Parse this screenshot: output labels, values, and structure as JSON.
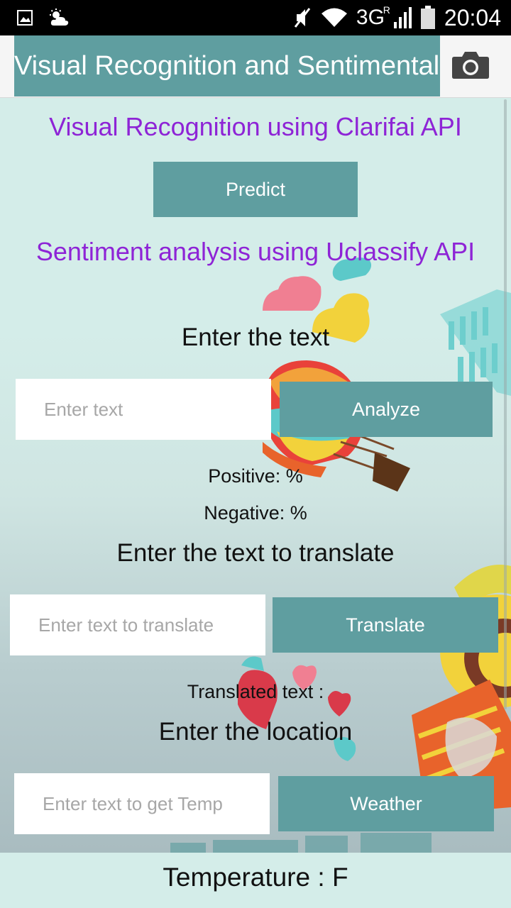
{
  "status_bar": {
    "network": "3G",
    "roaming": "R",
    "time": "20:04",
    "icons": [
      "image-icon",
      "weather-icon",
      "mute-icon",
      "wifi-icon",
      "signal-icon",
      "battery-icon"
    ]
  },
  "action_bar": {
    "title": "Visual Recognition and Sentimental Analysis",
    "camera_icon": "camera-icon"
  },
  "vision": {
    "heading": "Visual Recognition using Clarifai API",
    "predict_label": "Predict"
  },
  "sentiment": {
    "heading": "Sentiment analysis using Uclassify API",
    "prompt": "Enter the text",
    "input_placeholder": "Enter text",
    "analyze_label": "Analyze",
    "positive": "Positive: %",
    "negative": "Negative: %"
  },
  "translate": {
    "prompt": "Enter the text to translate",
    "input_placeholder": "Enter text to translate",
    "button_label": "Translate",
    "result": "Translated text :"
  },
  "weather": {
    "prompt": "Enter the location",
    "input_placeholder": "Enter text to get Temp",
    "button_label": "Weather"
  },
  "temperature": "Temperature : F",
  "colors": {
    "accent": "#5f9ea0",
    "heading_purple": "#8e24d6",
    "background": "#d4ede9"
  }
}
